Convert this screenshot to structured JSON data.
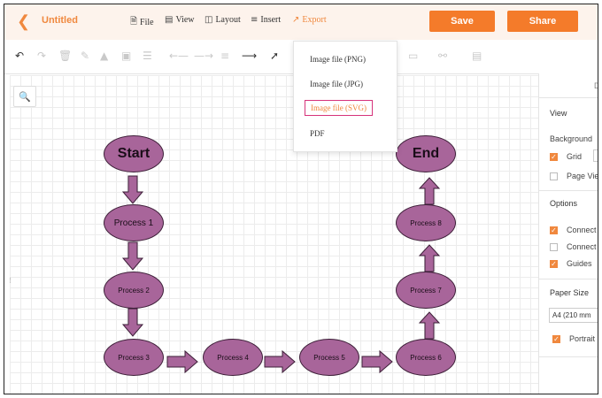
{
  "header": {
    "back_icon": "chevron-left-icon",
    "title": "Untitled",
    "menus": [
      {
        "icon": "file-icon",
        "label": "File"
      },
      {
        "icon": "view-icon",
        "label": "View"
      },
      {
        "icon": "layout-icon",
        "label": "Layout"
      },
      {
        "icon": "insert-icon",
        "label": "Insert"
      },
      {
        "icon": "export-icon",
        "label": "Export"
      }
    ],
    "save_label": "Save",
    "share_label": "Share",
    "accent_color": "#f47b2a"
  },
  "export_menu": {
    "items": [
      "Image file  (PNG)",
      "Image file  (JPG)",
      "Image file  (SVG)",
      "PDF"
    ],
    "selected": "Image file  (SVG)"
  },
  "flowchart": {
    "node_color": "#a8659a",
    "nodes": [
      "Start",
      "Process 1",
      "Process 2",
      "Process 3",
      "Process 4",
      "Process 5",
      "Process 6",
      "Process 7",
      "Process 8",
      "End"
    ]
  },
  "right_panel": {
    "tab_label": "D",
    "view_heading": "View",
    "background_label": "Background",
    "grid_label": "Grid",
    "grid_checked": true,
    "page_view_label": "Page Vie",
    "page_view_checked": false,
    "options_heading": "Options",
    "connect1_label": "Connect",
    "connect1_checked": true,
    "connect2_label": "Connect",
    "connect2_checked": false,
    "guides_label": "Guides",
    "guides_checked": true,
    "paper_size_heading": "Paper Size",
    "paper_size_value": "A4 (210 mm",
    "portrait_label": "Portrait",
    "portrait_checked": true
  }
}
